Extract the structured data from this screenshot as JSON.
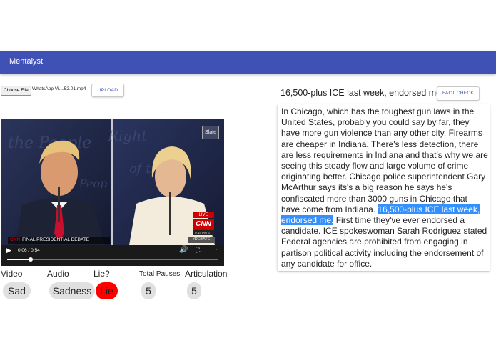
{
  "app": {
    "title": "Mentalyst"
  },
  "upload": {
    "choose_label": "Choose File",
    "file_name": "WhatsApp Vi....52.01.mp4",
    "upload_label": "UPLOAD"
  },
  "video": {
    "watermark": "Slate",
    "cnn_bug_text": "CNN",
    "lower_third": "FINAL PRESIDENTIAL DEBATE",
    "live_label": "LIVE",
    "cnn_logo": "CNN",
    "clock": "9:14 PM ET",
    "hashtag": "#DEBATE",
    "time_display": "0:06 / 0:54",
    "progress": 0.11
  },
  "results": {
    "labels": {
      "video": "Video",
      "audio": "Audio",
      "lie": "Lie?",
      "pauses": "Total Pauses",
      "articulation": "Articulation"
    },
    "values": {
      "video": "Sad",
      "audio": "Sadness",
      "lie": "Lie",
      "pauses": "5",
      "articulation": "5"
    },
    "lie_color": "#ff0000"
  },
  "claim": {
    "text": "16,500-plus ICE last week, endorsed me.",
    "fact_check_label": "FACT CHECK"
  },
  "transcript": {
    "before": "In Chicago, which has the toughest gun laws in the United States, probably you could say by far, they have more gun violence than any other city. Firearms are cheaper in Indiana. There's less detection, there are less requirements in Indiana and that's why we are seeing this steady flow and large volume of crime originating better. Chicago police superintendent Gary McArthur says its's a big reason he says he's confiscated more than 3000 guns in Chicago that have come from Indiana. ",
    "highlight": "16,500-plus ICE last week, endorsed me.",
    "after": " First time they've ever endorsed a candidate. ICE spokeswoman Sarah Rodriguez stated Federal agencies are prohibited from engaging in partison political activity including the endorsement of any candidate for office."
  },
  "colors": {
    "appbar": "#3f51b5",
    "highlight": "#3390ff"
  }
}
